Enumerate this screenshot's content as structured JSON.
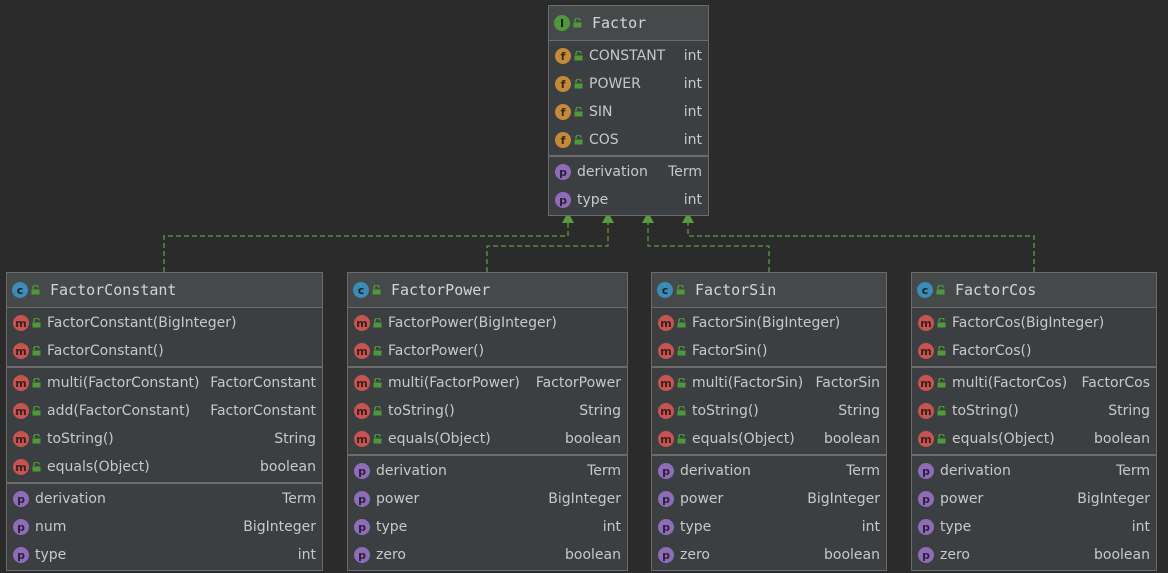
{
  "colors": {
    "background": "#2b2b2b",
    "box": "#3c3f41",
    "border": "#6b6b6b",
    "connector": "#5b9a3f",
    "interface_icon": "#4e9a3a",
    "class_icon": "#3b8cb8",
    "method_icon": "#c75450",
    "field_icon": "#c48a3a",
    "property_icon": "#8f6cb8"
  },
  "interface": {
    "icon": "interface-icon",
    "icon_letter": "I",
    "name": "Factor",
    "fields": [
      {
        "icon_letter": "f",
        "name": "CONSTANT",
        "type": "int"
      },
      {
        "icon_letter": "f",
        "name": "POWER",
        "type": "int"
      },
      {
        "icon_letter": "f",
        "name": "SIN",
        "type": "int"
      },
      {
        "icon_letter": "f",
        "name": "COS",
        "type": "int"
      }
    ],
    "properties": [
      {
        "icon_letter": "p",
        "name": "derivation",
        "type": "Term"
      },
      {
        "icon_letter": "p",
        "name": "type",
        "type": "int"
      }
    ]
  },
  "classes": [
    {
      "icon_letter": "c",
      "name": "FactorConstant",
      "constructors": [
        {
          "icon_letter": "m",
          "name": "FactorConstant(BigInteger)",
          "type": ""
        },
        {
          "icon_letter": "m",
          "name": "FactorConstant()",
          "type": ""
        }
      ],
      "methods": [
        {
          "icon_letter": "m",
          "name": "multi(FactorConstant)",
          "type": "FactorConstant"
        },
        {
          "icon_letter": "m",
          "name": "add(FactorConstant)",
          "type": "FactorConstant"
        },
        {
          "icon_letter": "m",
          "name": "toString()",
          "type": "String"
        },
        {
          "icon_letter": "m",
          "name": "equals(Object)",
          "type": "boolean"
        }
      ],
      "properties": [
        {
          "icon_letter": "p",
          "name": "derivation",
          "type": "Term"
        },
        {
          "icon_letter": "p",
          "name": "num",
          "type": "BigInteger"
        },
        {
          "icon_letter": "p",
          "name": "type",
          "type": "int"
        }
      ]
    },
    {
      "icon_letter": "c",
      "name": "FactorPower",
      "constructors": [
        {
          "icon_letter": "m",
          "name": "FactorPower(BigInteger)",
          "type": ""
        },
        {
          "icon_letter": "m",
          "name": "FactorPower()",
          "type": ""
        }
      ],
      "methods": [
        {
          "icon_letter": "m",
          "name": "multi(FactorPower)",
          "type": "FactorPower"
        },
        {
          "icon_letter": "m",
          "name": "toString()",
          "type": "String"
        },
        {
          "icon_letter": "m",
          "name": "equals(Object)",
          "type": "boolean"
        }
      ],
      "properties": [
        {
          "icon_letter": "p",
          "name": "derivation",
          "type": "Term"
        },
        {
          "icon_letter": "p",
          "name": "power",
          "type": "BigInteger"
        },
        {
          "icon_letter": "p",
          "name": "type",
          "type": "int"
        },
        {
          "icon_letter": "p",
          "name": "zero",
          "type": "boolean"
        }
      ]
    },
    {
      "icon_letter": "c",
      "name": "FactorSin",
      "constructors": [
        {
          "icon_letter": "m",
          "name": "FactorSin(BigInteger)",
          "type": ""
        },
        {
          "icon_letter": "m",
          "name": "FactorSin()",
          "type": ""
        }
      ],
      "methods": [
        {
          "icon_letter": "m",
          "name": "multi(FactorSin)",
          "type": "FactorSin"
        },
        {
          "icon_letter": "m",
          "name": "toString()",
          "type": "String"
        },
        {
          "icon_letter": "m",
          "name": "equals(Object)",
          "type": "boolean"
        }
      ],
      "properties": [
        {
          "icon_letter": "p",
          "name": "derivation",
          "type": "Term"
        },
        {
          "icon_letter": "p",
          "name": "power",
          "type": "BigInteger"
        },
        {
          "icon_letter": "p",
          "name": "type",
          "type": "int"
        },
        {
          "icon_letter": "p",
          "name": "zero",
          "type": "boolean"
        }
      ]
    },
    {
      "icon_letter": "c",
      "name": "FactorCos",
      "constructors": [
        {
          "icon_letter": "m",
          "name": "FactorCos(BigInteger)",
          "type": ""
        },
        {
          "icon_letter": "m",
          "name": "FactorCos()",
          "type": ""
        }
      ],
      "methods": [
        {
          "icon_letter": "m",
          "name": "multi(FactorCos)",
          "type": "FactorCos"
        },
        {
          "icon_letter": "m",
          "name": "toString()",
          "type": "String"
        },
        {
          "icon_letter": "m",
          "name": "equals(Object)",
          "type": "boolean"
        }
      ],
      "properties": [
        {
          "icon_letter": "p",
          "name": "derivation",
          "type": "Term"
        },
        {
          "icon_letter": "p",
          "name": "power",
          "type": "BigInteger"
        },
        {
          "icon_letter": "p",
          "name": "type",
          "type": "int"
        },
        {
          "icon_letter": "p",
          "name": "zero",
          "type": "boolean"
        }
      ]
    }
  ]
}
